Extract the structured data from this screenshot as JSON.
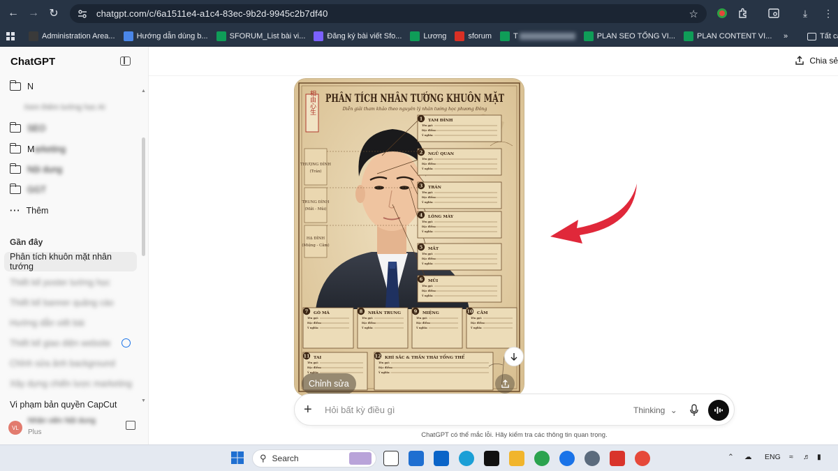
{
  "browser": {
    "url": "chatgpt.com/c/6a1511e4-a1c4-83ec-9b2d-9945c2b7df40",
    "bookmarks": [
      {
        "label": "Administration Area...",
        "color": "#3a3a3a"
      },
      {
        "label": "Hướng dẫn dùng b...",
        "color": "#4a86e8"
      },
      {
        "label": "SFORUM_List bài vi...",
        "color": "#0f9d58"
      },
      {
        "label": "Đăng ký bài viết Sfo...",
        "color": "#7b61ff"
      },
      {
        "label": "Lương",
        "color": "#0f9d58"
      },
      {
        "label": "sforum",
        "color": "#d93025"
      },
      {
        "label": "T",
        "color": "#0f9d58"
      },
      {
        "label": "PLAN SEO TỔNG VI...",
        "color": "#0f9d58"
      },
      {
        "label": "PLAN CONTENT VI...",
        "color": "#0f9d58"
      }
    ],
    "all_bookmarks": "Tất cả"
  },
  "sidebar": {
    "title": "ChatGPT",
    "folders": [
      {
        "label": "N",
        "blurred_label": ""
      },
      {
        "label": "",
        "blurred_label": "Xem thêm tướng học AI"
      },
      {
        "label": "",
        "blurred_label": "SEO"
      },
      {
        "label": "M",
        "blurred_label": "arketing"
      },
      {
        "label": "",
        "blurred_label": "Nội dung"
      },
      {
        "label": "",
        "blurred_label": "GGT"
      }
    ],
    "more_label": "Thêm",
    "recent_heading": "Gần đây",
    "recent": [
      {
        "label": "Phân tích khuôn mặt nhân tướng",
        "blurred": false
      },
      {
        "label": "Thiết kế poster tướng học",
        "blurred": true
      },
      {
        "label": "Thiết kế banner quảng cáo",
        "blurred": true
      },
      {
        "label": "Hướng dẫn viết bài",
        "blurred": true
      },
      {
        "label": "Thiết kế giao diện website",
        "blurred": true
      },
      {
        "label": "Chỉnh sửa ảnh background",
        "blurred": true
      },
      {
        "label": "Xây dựng chiến lược marketing",
        "blurred": true
      },
      {
        "label": "Vi phạm bản quyền CapCut",
        "blurred": false
      }
    ],
    "user": {
      "initials": "VL",
      "name": "Nhân viên Nội dung",
      "plan": "Plus"
    }
  },
  "header": {
    "share_label": "Chia sẻ"
  },
  "poster": {
    "title": "PHÂN TÍCH NHÂN TƯỚNG KHUÔN MẶT",
    "subtitle": "Diễn giải tham khảo theo nguyên lý nhân tướng học phương Đông",
    "seal": "相由心生",
    "zones": [
      {
        "label": "THƯỢNG ĐÌNH",
        "sub": "(Trán)"
      },
      {
        "label": "TRUNG ĐÌNH",
        "sub": "(Mắt - Mũi)"
      },
      {
        "label": "HẠ ĐÌNH",
        "sub": "(Miệng - Cằm)"
      }
    ],
    "right_panels": [
      {
        "num": "1",
        "title": "TAM ĐÌNH"
      },
      {
        "num": "2",
        "title": "NGŨ QUAN"
      },
      {
        "num": "3",
        "title": "TRÁN"
      },
      {
        "num": "4",
        "title": "LÔNG MÀY"
      },
      {
        "num": "5",
        "title": "MẮT"
      },
      {
        "num": "6",
        "title": "MŨI"
      }
    ],
    "bottom_panels": [
      {
        "num": "7",
        "title": "GÒ MÁ"
      },
      {
        "num": "8",
        "title": "NHÂN TRUNG"
      },
      {
        "num": "9",
        "title": "MIỆNG"
      },
      {
        "num": "10",
        "title": "CẰM"
      }
    ],
    "footer_panels": [
      {
        "num": "11",
        "title": "TAI"
      },
      {
        "num": "12",
        "title": "KHÍ SẮC & THẦN THÁI TỔNG THỂ"
      }
    ],
    "field_labels": [
      "Tên gọi:",
      "Đặc điểm:",
      "Ý nghĩa:"
    ]
  },
  "image_actions": {
    "edit_label": "Chỉnh sửa"
  },
  "composer": {
    "placeholder": "Hỏi bất kỳ điều gì",
    "model_label": "Thinking"
  },
  "disclaimer": "ChatGPT có thể mắc lỗi. Hãy kiểm tra các thông tin quan trọng.",
  "taskbar": {
    "search_label": "Search",
    "language": "ENG"
  },
  "colors": {
    "arrow": "#e0283a",
    "poster_bg": "#e8d6b1",
    "poster_ink": "#5a3d22"
  }
}
